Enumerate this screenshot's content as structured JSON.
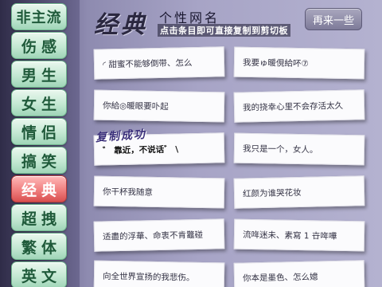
{
  "sidebar": {
    "items": [
      {
        "label": "非主流",
        "active": false
      },
      {
        "label": "伤感",
        "active": false
      },
      {
        "label": "男生",
        "active": false
      },
      {
        "label": "女生",
        "active": false
      },
      {
        "label": "情侣",
        "active": false
      },
      {
        "label": "搞笑",
        "active": false
      },
      {
        "label": "经典",
        "active": true
      },
      {
        "label": "超拽",
        "active": false
      },
      {
        "label": "繁体",
        "active": false
      },
      {
        "label": "英文",
        "active": false
      }
    ]
  },
  "header": {
    "logo": "经典",
    "title": "个性网名",
    "tip": "点击条目即可直接复制到剪切板",
    "refresh_label": "再来一些"
  },
  "copied_text": "复制成功",
  "colors": {
    "nav_normal": "#c4e8d3",
    "nav_active": "#f07f7f",
    "nav_text": "#1f5a3a",
    "card_bg": "#fbfbfd"
  },
  "names": [
    "◜ 甜蜜不能够倒带、怎么",
    "我要ゅ暖俔給吥⑦",
    "你給◎暖眼要卟起",
    "我的挠幸心里不会存活太久",
    "゛ 靠近，不说话゛ \\",
    "我只是一个，女人。",
    "你干杯我随意",
    "红颜为谁哭花妆",
    "适盡的浮華、命衷不肯龞碰",
    "流哖迷未、素寫 1 卋哖嘩",
    "向全世界宣扬的我悲伤。",
    "你本是墨色、怎么嬑"
  ]
}
